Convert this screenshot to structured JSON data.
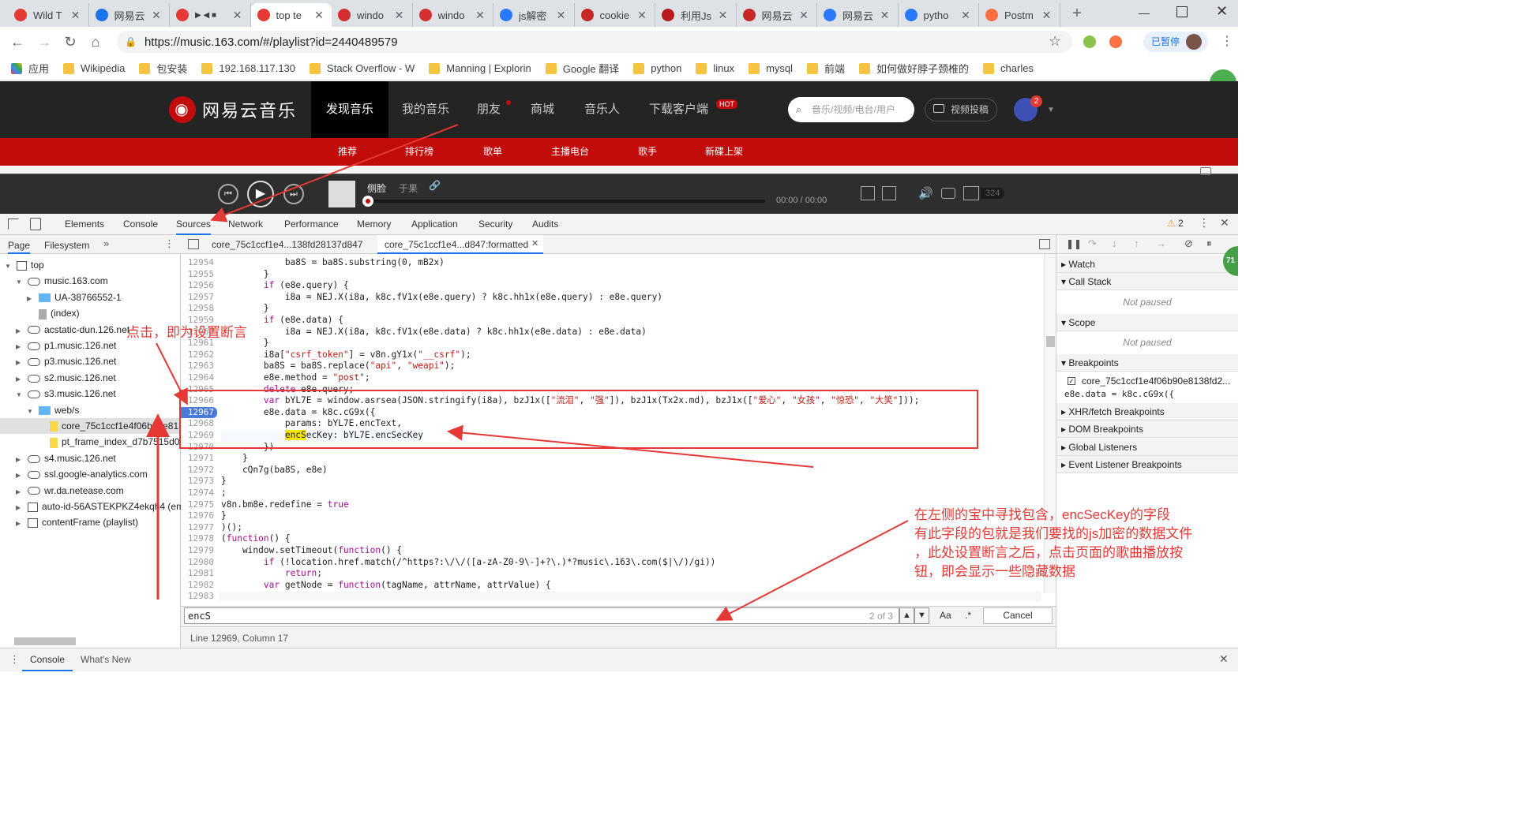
{
  "browser": {
    "tabs": [
      {
        "title": "Wild T",
        "color": "#e53935"
      },
      {
        "title": "网易云",
        "color": "#1a73e8"
      },
      {
        "title": "",
        "color": "#e53935"
      },
      {
        "title": "top te",
        "color": "#e53935",
        "active": true
      },
      {
        "title": "windo",
        "color": "#d32f2f"
      },
      {
        "title": "windo",
        "color": "#d32f2f"
      },
      {
        "title": "js解密",
        "color": "#2979ff"
      },
      {
        "title": "cookie",
        "color": "#c62828"
      },
      {
        "title": "利用Js",
        "color": "#b71c1c"
      },
      {
        "title": "网易云",
        "color": "#c62828"
      },
      {
        "title": "网易云",
        "color": "#2979ff"
      },
      {
        "title": "pytho",
        "color": "#2979ff"
      },
      {
        "title": "Postm",
        "color": "#ff7043"
      }
    ],
    "url": "https://music.163.com/#/playlist?id=2440489579",
    "paused_label": "已暂停",
    "bookmarks": [
      "应用",
      "Wikipedia",
      "包安装",
      "192.168.117.130",
      "Stack Overflow - W",
      "Manning | Explorin",
      "Google 翻译",
      "python",
      "linux",
      "mysql",
      "前端",
      "如何做好脖子颈椎的",
      "charles"
    ]
  },
  "netease": {
    "logo": "网易云音乐",
    "nav": [
      "发现音乐",
      "我的音乐",
      "朋友",
      "商城",
      "音乐人",
      "下载客户端"
    ],
    "hot_badge": "HOT",
    "search_placeholder": "音乐/视频/电台/用户",
    "upload_label": "视频投稿",
    "notif_count": "2",
    "subnav": [
      "推荐",
      "排行榜",
      "歌单",
      "主播电台",
      "歌手",
      "新碟上架"
    ],
    "player": {
      "song": "侧脸",
      "artist": "于果",
      "time": "00:00",
      "duration": "00:00",
      "count": "324"
    }
  },
  "devtools": {
    "tabs": [
      "Elements",
      "Console",
      "Sources",
      "Network",
      "Performance",
      "Memory",
      "Application",
      "Security",
      "Audits"
    ],
    "active_tab": "Sources",
    "warning_count": "2",
    "nav_tabs": [
      "Page",
      "Filesystem"
    ],
    "tree": [
      {
        "label": "top",
        "depth": 0,
        "type": "frame"
      },
      {
        "label": "music.163.com",
        "depth": 1,
        "type": "cloud"
      },
      {
        "label": "UA-38766552-1",
        "depth": 2,
        "type": "folder"
      },
      {
        "label": "(index)",
        "depth": 2,
        "type": "file"
      },
      {
        "label": "acstatic-dun.126.net",
        "depth": 1,
        "type": "cloud"
      },
      {
        "label": "p1.music.126.net",
        "depth": 1,
        "type": "cloud"
      },
      {
        "label": "p3.music.126.net",
        "depth": 1,
        "type": "cloud"
      },
      {
        "label": "s2.music.126.net",
        "depth": 1,
        "type": "cloud"
      },
      {
        "label": "s3.music.126.net",
        "depth": 1,
        "type": "cloud"
      },
      {
        "label": "web/s",
        "depth": 2,
        "type": "folder"
      },
      {
        "label": "core_75c1ccf1e4f06b90e813",
        "depth": 3,
        "type": "jsfile",
        "selected": true
      },
      {
        "label": "pt_frame_index_d7b7515d01",
        "depth": 3,
        "type": "jsfile"
      },
      {
        "label": "s4.music.126.net",
        "depth": 1,
        "type": "cloud"
      },
      {
        "label": "ssl.google-analytics.com",
        "depth": 1,
        "type": "cloud"
      },
      {
        "label": "wr.da.netease.com",
        "depth": 1,
        "type": "cloud"
      },
      {
        "label": "auto-id-56ASTEKPKZ4ekqh4 (ema",
        "depth": 1,
        "type": "frame"
      },
      {
        "label": "contentFrame (playlist)",
        "depth": 1,
        "type": "frame"
      }
    ],
    "editor_tabs": [
      "core_75c1ccf1e4...138fd28137d847",
      "core_75c1ccf1e4...d847:formatted"
    ],
    "code": [
      {
        "n": "12954",
        "t": "            ba8S = ba8S.substring(0, mB2x)"
      },
      {
        "n": "12955",
        "t": "        }"
      },
      {
        "n": "12956",
        "t": "        if (e8e.query) {"
      },
      {
        "n": "12957",
        "t": "            i8a = NEJ.X(i8a, k8c.fV1x(e8e.query) ? k8c.hh1x(e8e.query) : e8e.query)"
      },
      {
        "n": "12958",
        "t": "        }"
      },
      {
        "n": "12959",
        "t": "        if (e8e.data) {"
      },
      {
        "n": "12960",
        "t": "            i8a = NEJ.X(i8a, k8c.fV1x(e8e.data) ? k8c.hh1x(e8e.data) : e8e.data)"
      },
      {
        "n": "12961",
        "t": "        }"
      },
      {
        "n": "12962",
        "t": "        i8a[\"csrf_token\"] = v8n.gY1x(\"__csrf\");"
      },
      {
        "n": "12963",
        "t": "        ba8S = ba8S.replace(\"api\", \"weapi\");"
      },
      {
        "n": "12964",
        "t": "        e8e.method = \"post\";"
      },
      {
        "n": "12965",
        "t": "        delete e8e.query;"
      },
      {
        "n": "12966",
        "t": "        var bYL7E = window.asrsea(JSON.stringify(i8a), bzJ1x([\"流泪\", \"强\"]), bzJ1x(Tx2x.md), bzJ1x([\"爱心\", \"女孩\", \"惊恐\", \"大笑\"]));"
      },
      {
        "n": "12967",
        "t": "        e8e.data = k8c.cG9x({",
        "bp": true
      },
      {
        "n": "12968",
        "t": "            params: bYL7E.encText,"
      },
      {
        "n": "12969",
        "t": "            encSecKey: bYL7E.encSecKey"
      },
      {
        "n": "12970",
        "t": "        })"
      },
      {
        "n": "12971",
        "t": "    }"
      },
      {
        "n": "12972",
        "t": "    cQn7g(ba8S, e8e)"
      },
      {
        "n": "12973",
        "t": "}"
      },
      {
        "n": "12974",
        "t": ";"
      },
      {
        "n": "12975",
        "t": "v8n.bm8e.redefine = true"
      },
      {
        "n": "12976",
        "t": "}"
      },
      {
        "n": "12977",
        "t": ")();"
      },
      {
        "n": "12978",
        "t": "(function() {"
      },
      {
        "n": "12979",
        "t": "    window.setTimeout(function() {"
      },
      {
        "n": "12980",
        "t": "        if (!location.href.match(/^https?:\\/\\/([a-zA-Z0-9\\-]+?\\.)*?music\\.163\\.com($|\\/)/gi))"
      },
      {
        "n": "12981",
        "t": "            return;"
      },
      {
        "n": "12982",
        "t": "        var getNode = function(tagName, attrName, attrValue) {"
      },
      {
        "n": "12983",
        "t": ""
      }
    ],
    "search": {
      "query": "encS",
      "match": "2 of 3",
      "aa": "Aa",
      "regex": ".*",
      "cancel": "Cancel"
    },
    "status": "Line 12969, Column 17",
    "debugger": {
      "watch": "Watch",
      "callstack": "Call Stack",
      "not_paused": "Not paused",
      "scope": "Scope",
      "breakpoints": "Breakpoints",
      "bp_file": "core_75c1ccf1e4f06b90e8138fd2...",
      "bp_code": "e8e.data = k8c.cG9x({",
      "xhr": "XHR/fetch Breakpoints",
      "dom": "DOM Breakpoints",
      "global": "Global Listeners",
      "event": "Event Listener Breakpoints"
    },
    "drawer_tabs": [
      "Console",
      "What's New"
    ]
  },
  "annotations": {
    "left_note": "点击，即为设置断言",
    "right_note_1": "在左侧的宝中寻找包含，encSecKey的字段",
    "right_note_2": "有此字段的包就是我们要找的js加密的数据文件",
    "right_note_3": "，此处设置断言之后，点击页面的歌曲播放按",
    "right_note_4": "钮，即会显示一些隐藏数据"
  },
  "colors": {
    "annotation": "#e53935",
    "netease_red": "#c20c0c",
    "netease_dark": "#242424"
  }
}
